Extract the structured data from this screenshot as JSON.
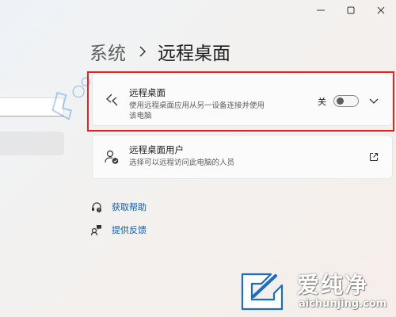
{
  "window": {
    "controls": [
      "minimize",
      "maximize",
      "close"
    ]
  },
  "breadcrumb": {
    "parent": "系统",
    "separator_icon": "chevron-right-icon",
    "current": "远程桌面"
  },
  "remote_desktop": {
    "title": "远程桌面",
    "description": "使用远程桌面应用从另一设备连接并使用该电脑",
    "toggle_label": "关",
    "toggle_on": false,
    "icon": "remote-desktop-icon"
  },
  "remote_users": {
    "title": "远程桌面用户",
    "description": "选择可以远程访问此电脑的人员",
    "icon": "users-check-icon",
    "action_icon": "open-external-icon"
  },
  "links": {
    "help": "获取帮助",
    "feedback": "提供反馈"
  },
  "watermark": {
    "name": "爱纯净",
    "url": "aichunjing.com"
  },
  "colors": {
    "highlight": "#e02424",
    "link": "#0b5cad",
    "card_bg": "#fbfbfb"
  }
}
